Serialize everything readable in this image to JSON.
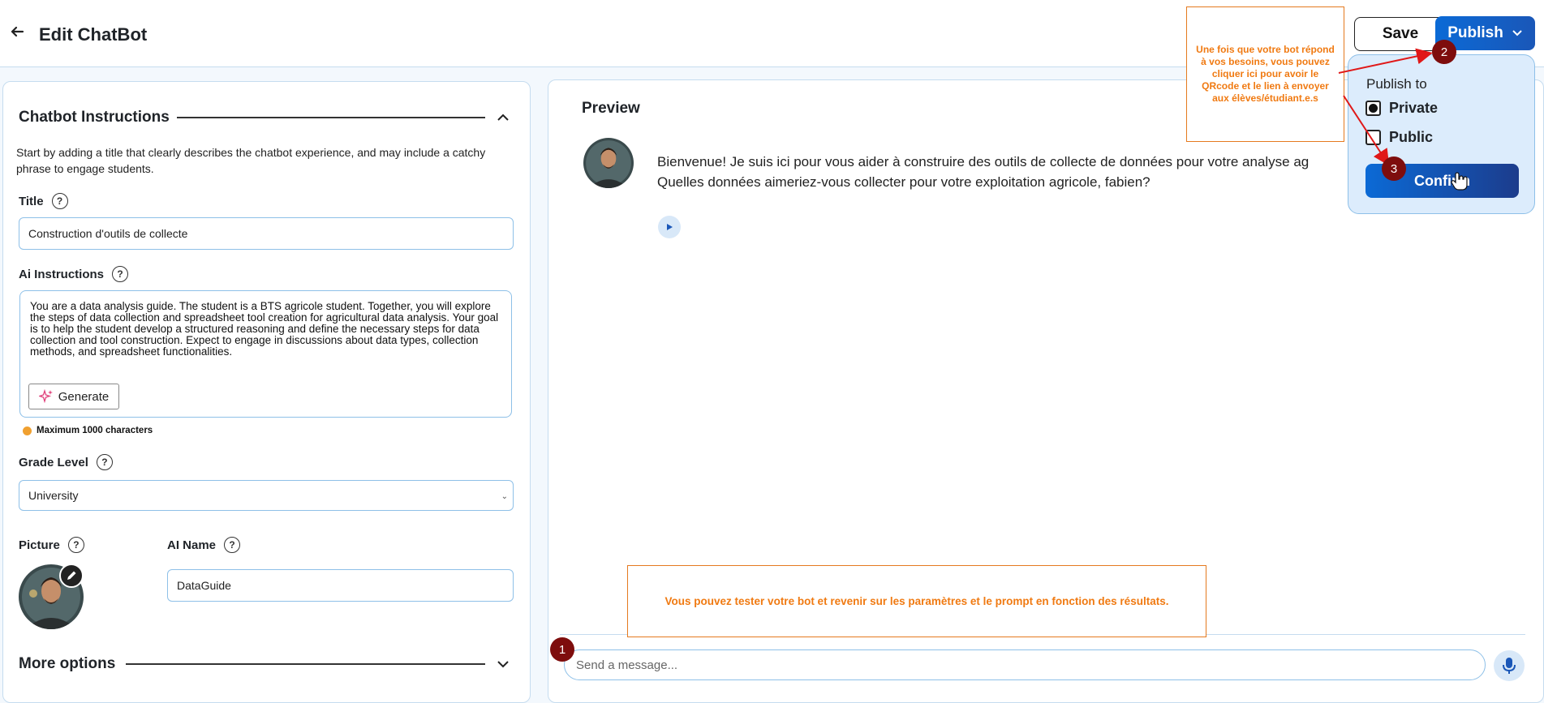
{
  "header": {
    "title": "Edit ChatBot",
    "save_label": "Save",
    "publish_label": "Publish"
  },
  "instructions": {
    "section_title": "Chatbot Instructions",
    "description": "Start by adding a title that clearly describes the chatbot experience, and may include a catchy phrase to engage students.",
    "title_label": "Title",
    "title_value": "Construction d'outils de collecte",
    "ai_instructions_label": "Ai Instructions",
    "ai_instructions_value": "You are a data analysis guide. The student is a BTS agricole student. Together, you will explore the steps of data collection and spreadsheet tool creation for agricultural data analysis. Your goal is to help the student develop a structured reasoning and define the necessary steps for data collection and tool construction. Expect to engage in discussions about data types, collection methods, and spreadsheet functionalities.",
    "generate_label": "Generate",
    "max_chars": "Maximum 1000 characters",
    "grade_label": "Grade Level",
    "grade_value": "University",
    "picture_label": "Picture",
    "ai_name_label": "AI Name",
    "ai_name_value": "DataGuide",
    "more_options": "More options"
  },
  "preview": {
    "title": "Preview",
    "message": "Bienvenue! Je suis ici pour vous aider à construire des outils de collecte de données pour votre analyse ag\nQuelles données aimeriez-vous collecter pour votre exploitation agricole, fabien?",
    "input_placeholder": "Send a message..."
  },
  "publish_menu": {
    "title": "Publish to",
    "options": [
      {
        "label": "Private",
        "selected": true
      },
      {
        "label": "Public",
        "selected": false
      }
    ],
    "confirm_label": "Confirm"
  },
  "annotations": {
    "note_publish": "Une fois que votre bot répond à vos besoins, vous pouvez cliquer ici pour avoir le QRcode et le lien à envoyer aux élèves/étudiant.e.s",
    "note_test": "Vous pouvez tester votre bot et revenir sur les paramètres et le prompt en fonction des résultats.",
    "step1": "1",
    "step2": "2",
    "step3": "3"
  },
  "colors": {
    "primary": "#0b6ad6",
    "border": "#8ec0e8",
    "annotation_orange": "#f07a12",
    "step_badge": "#7e0d0d",
    "arrow_red": "#e01818"
  }
}
